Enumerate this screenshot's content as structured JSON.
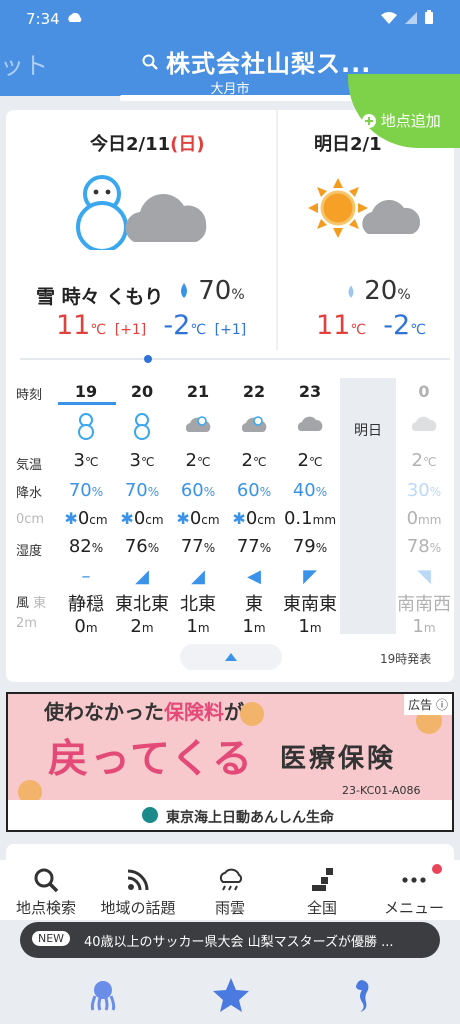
{
  "status": {
    "time": "7:34"
  },
  "header": {
    "prev_label": "ット",
    "title": "株式会社山梨ス...",
    "subtitle": "大月市"
  },
  "add_location": "地点追加",
  "today": {
    "label": "今日2/11",
    "weekday": "(日)",
    "condition": "雪 時々 くもり",
    "precip": "70",
    "precip_unit": "%",
    "high": "11",
    "high_diff": "[+1]",
    "low": "-2",
    "low_diff": "[+1]",
    "unit": "℃"
  },
  "tomorrow": {
    "label": "明日2/1",
    "precip": "20",
    "precip_unit": "%",
    "high": "11",
    "low": "-2",
    "unit": "℃"
  },
  "table": {
    "labels": {
      "hour": "時刻",
      "temp": "気温",
      "precip": "降水",
      "snow_hidden": "0cm",
      "humidity": "湿度",
      "wind": "風",
      "wind_hidden": "東",
      "wind_speed_hidden": "2m"
    },
    "tomorrow_label": "明日",
    "hours": [
      {
        "hour": "19",
        "temp": "3",
        "precip": "70",
        "snow": "0",
        "snow_unit": "cm",
        "humidity": "82",
        "wind_dir": "静穏",
        "wind_speed": "0",
        "wind_arrow": "–",
        "icon": "snowman-icon"
      },
      {
        "hour": "20",
        "temp": "3",
        "precip": "70",
        "snow": "0",
        "snow_unit": "cm",
        "humidity": "76",
        "wind_dir": "東北東",
        "wind_speed": "2",
        "wind_arrow": "◢",
        "icon": "snowman-icon"
      },
      {
        "hour": "21",
        "temp": "2",
        "precip": "60",
        "snow": "0",
        "snow_unit": "cm",
        "humidity": "77",
        "wind_dir": "北東",
        "wind_speed": "1",
        "wind_arrow": "◢",
        "icon": "cloud-snow-icon"
      },
      {
        "hour": "22",
        "temp": "2",
        "precip": "60",
        "snow": "0",
        "snow_unit": "cm",
        "humidity": "77",
        "wind_dir": "東",
        "wind_speed": "1",
        "wind_arrow": "◀",
        "icon": "cloud-snow-icon"
      },
      {
        "hour": "23",
        "temp": "2",
        "precip": "40",
        "snow": "0.1",
        "snow_unit": "mm",
        "humidity": "79",
        "wind_dir": "東南東",
        "wind_speed": "1",
        "wind_arrow": "◤",
        "icon": "cloud-icon"
      },
      {
        "hour": "0",
        "temp": "2",
        "precip": "30",
        "snow": "0",
        "snow_unit": "mm",
        "humidity": "78",
        "wind_dir": "南南西",
        "wind_speed": "1",
        "wind_arrow": "◥",
        "icon": "cloud-icon"
      }
    ],
    "temp_unit": "℃",
    "pct_unit": "%",
    "m_unit": "m",
    "issued": "19時発表"
  },
  "ad": {
    "badge": "広告",
    "line1_pre": "使わなかった",
    "line1_pink": "保険料",
    "line1_post": "が",
    "line2": "戻ってくる",
    "line3": "医療保険",
    "code": "23-KC01-A086",
    "sponsor": "東京海上日動あんしん生命"
  },
  "nav": {
    "items": [
      "地点検索",
      "地域の話題",
      "雨雲",
      "全国",
      "メニュー"
    ]
  },
  "news": {
    "badge": "NEW",
    "text": "40歳以上のサッカー県大会 山梨マスターズが優勝 ..."
  },
  "colors": {
    "accent": "#4a90e2",
    "high": "#e0413e",
    "low": "#2e74d8",
    "precip": "#3a93e8",
    "add": "#7ed24a"
  }
}
